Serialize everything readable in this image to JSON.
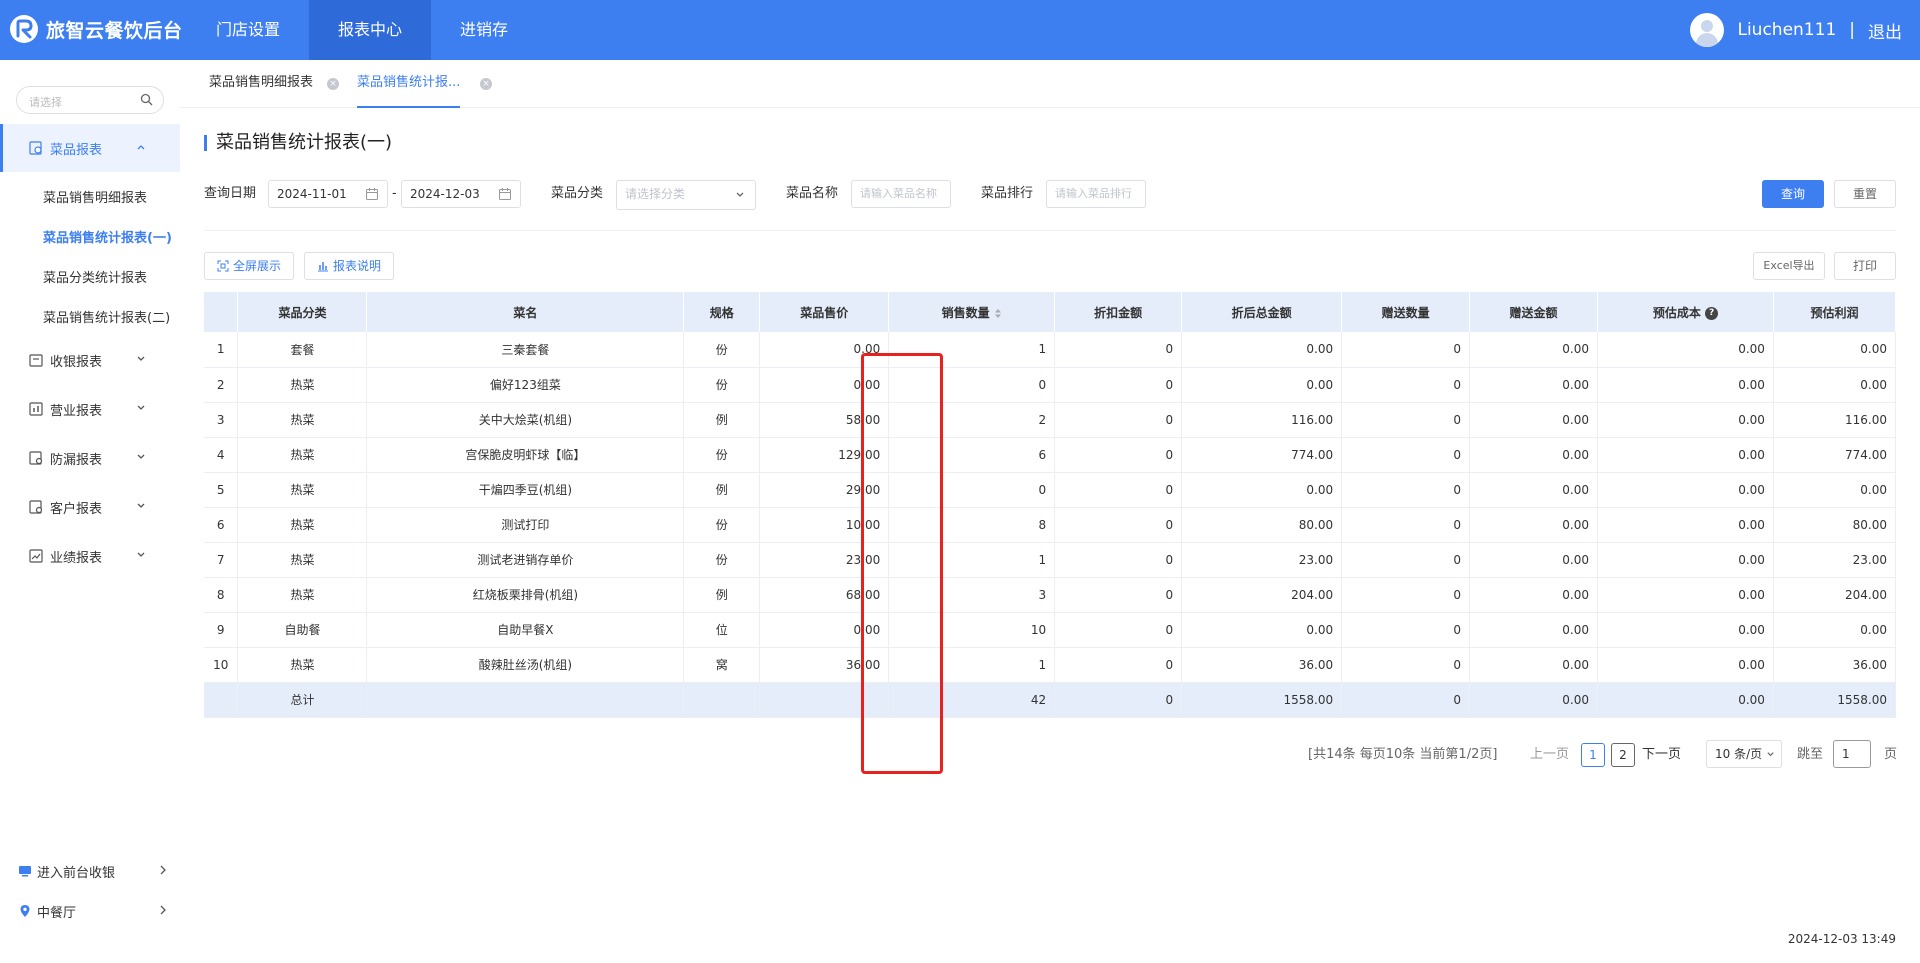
{
  "app": {
    "title": "旅智云餐饮后台"
  },
  "topnav": {
    "items": [
      {
        "label": "门店设置"
      },
      {
        "label": "报表中心"
      },
      {
        "label": "进销存"
      }
    ]
  },
  "user": {
    "name": "Liuchen111",
    "separator": "|",
    "logout": "退出"
  },
  "sidebar": {
    "search_placeholder": "请选择",
    "report_group": {
      "label": "菜品报表",
      "items": [
        {
          "label": "菜品销售明细报表"
        },
        {
          "label": "菜品销售统计报表(一)"
        },
        {
          "label": "菜品分类统计报表"
        },
        {
          "label": "菜品销售统计报表(二)"
        }
      ]
    },
    "groups": [
      {
        "label": "收银报表"
      },
      {
        "label": "营业报表"
      },
      {
        "label": "防漏报表"
      },
      {
        "label": "客户报表"
      },
      {
        "label": "业绩报表"
      }
    ],
    "bottom": [
      {
        "label": "进入前台收银"
      },
      {
        "label": "中餐厅"
      }
    ]
  },
  "tabs": [
    {
      "label": "菜品销售明细报表"
    },
    {
      "label": "菜品销售统计报..."
    }
  ],
  "page": {
    "title": "菜品销售统计报表(一)"
  },
  "filters": {
    "date_label": "查询日期",
    "date_start": "2024-11-01",
    "date_sep": "-",
    "date_end": "2024-12-03",
    "category_label": "菜品分类",
    "category_placeholder": "请选择分类",
    "name_label": "菜品名称",
    "name_placeholder": "请输入菜品名称",
    "rank_label": "菜品排行",
    "rank_placeholder": "请输入菜品排行",
    "query_button": "查询",
    "reset_button": "重置"
  },
  "toolbar": {
    "fullscreen": "全屏展示",
    "explain": "报表说明",
    "excel": "Excel导出",
    "print": "打印"
  },
  "table": {
    "headers": [
      "",
      "菜品分类",
      "菜名",
      "规格",
      "菜品售价",
      "销售数量",
      "折扣金额",
      "折后总金额",
      "赠送数量",
      "赠送金额",
      "预估成本",
      "预估利润"
    ],
    "rows": [
      [
        "1",
        "套餐",
        "三秦套餐",
        "份",
        "0.00",
        "1",
        "0",
        "0.00",
        "0",
        "0.00",
        "0.00",
        "0.00"
      ],
      [
        "2",
        "热菜",
        "偏好123组菜",
        "份",
        "0.00",
        "0",
        "0",
        "0.00",
        "0",
        "0.00",
        "0.00",
        "0.00"
      ],
      [
        "3",
        "热菜",
        "关中大烩菜(机组)",
        "例",
        "58.00",
        "2",
        "0",
        "116.00",
        "0",
        "0.00",
        "0.00",
        "116.00"
      ],
      [
        "4",
        "热菜",
        "宫保脆皮明虾球【临】",
        "份",
        "129.00",
        "6",
        "0",
        "774.00",
        "0",
        "0.00",
        "0.00",
        "774.00"
      ],
      [
        "5",
        "热菜",
        "干煸四季豆(机组)",
        "例",
        "29.00",
        "0",
        "0",
        "0.00",
        "0",
        "0.00",
        "0.00",
        "0.00"
      ],
      [
        "6",
        "热菜",
        "测试打印",
        "份",
        "10.00",
        "8",
        "0",
        "80.00",
        "0",
        "0.00",
        "0.00",
        "80.00"
      ],
      [
        "7",
        "热菜",
        "测试老进销存单价",
        "份",
        "23.00",
        "1",
        "0",
        "23.00",
        "0",
        "0.00",
        "0.00",
        "23.00"
      ],
      [
        "8",
        "热菜",
        "红烧板栗排骨(机组)",
        "例",
        "68.00",
        "3",
        "0",
        "204.00",
        "0",
        "0.00",
        "0.00",
        "204.00"
      ],
      [
        "9",
        "自助餐",
        "自助早餐X",
        "位",
        "0.00",
        "10",
        "0",
        "0.00",
        "0",
        "0.00",
        "0.00",
        "0.00"
      ],
      [
        "10",
        "热菜",
        "酸辣肚丝汤(机组)",
        "窝",
        "36.00",
        "1",
        "0",
        "36.00",
        "0",
        "0.00",
        "0.00",
        "36.00"
      ]
    ],
    "total": {
      "label": "总计",
      "qty": "42",
      "discount": "0",
      "after_total": "1558.00",
      "gift_qty": "0",
      "gift_amount": "0.00",
      "cost": "0.00",
      "profit": "1558.00"
    }
  },
  "pagination": {
    "summary": "[共14条 每页10条 当前第1/2页]",
    "prev": "上一页",
    "pages": [
      "1",
      "2"
    ],
    "next": "下一页",
    "page_size": "10 条/页",
    "jump_label": "跳至",
    "jump_value": "1",
    "page_suffix": "页"
  },
  "footer": {
    "timestamp": "2024-12-03 13:49"
  },
  "colors": {
    "primary": "#3d7ff0",
    "highlight_box": "#e8211e",
    "header_bg": "#e6edfa"
  }
}
